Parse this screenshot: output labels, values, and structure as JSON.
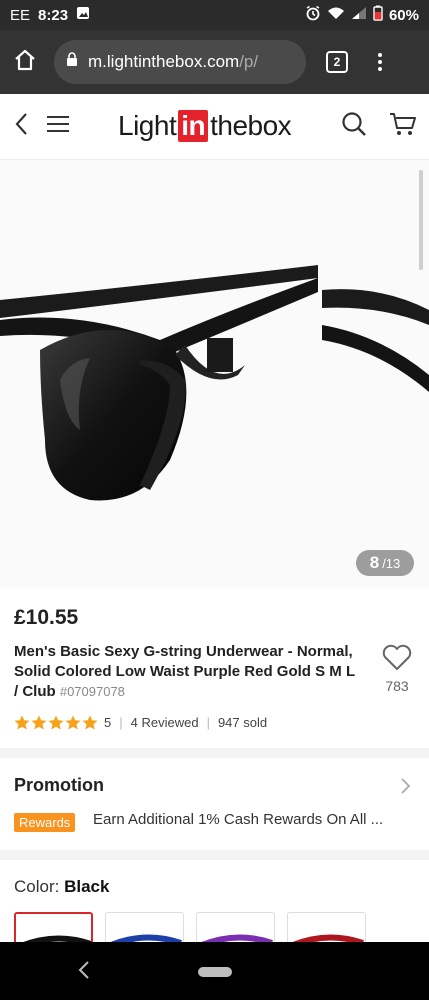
{
  "status": {
    "carrier": "EE",
    "time": "8:23",
    "battery": "60%"
  },
  "browser": {
    "url": "m.lightinthebox.com",
    "url_tail": "/p/",
    "tab_count": "2"
  },
  "header": {
    "logo_left": "Light",
    "logo_mid": "in",
    "logo_right": "thebox"
  },
  "gallery": {
    "current": "8",
    "total": "/13"
  },
  "product": {
    "price": "£10.55",
    "title": "Men's Basic Sexy G-string Underwear - Normal, Solid Colored Low Waist Purple Red Gold S M L / Club",
    "sku": "#07097078",
    "favorites": "783",
    "rating": "5",
    "reviews": "4 Reviewed",
    "sold": "947 sold",
    "stars": 5
  },
  "promotion": {
    "title": "Promotion",
    "tag": "Rewards",
    "text": "Earn Additional 1% Cash Rewards On All ..."
  },
  "color": {
    "label": "Color: ",
    "value": "Black",
    "swatches": [
      "black",
      "blue",
      "purple",
      "red",
      "gold"
    ]
  },
  "colors": {
    "accent": "#e3222b",
    "star": "#f7a21b",
    "tag": "#f7931e"
  }
}
